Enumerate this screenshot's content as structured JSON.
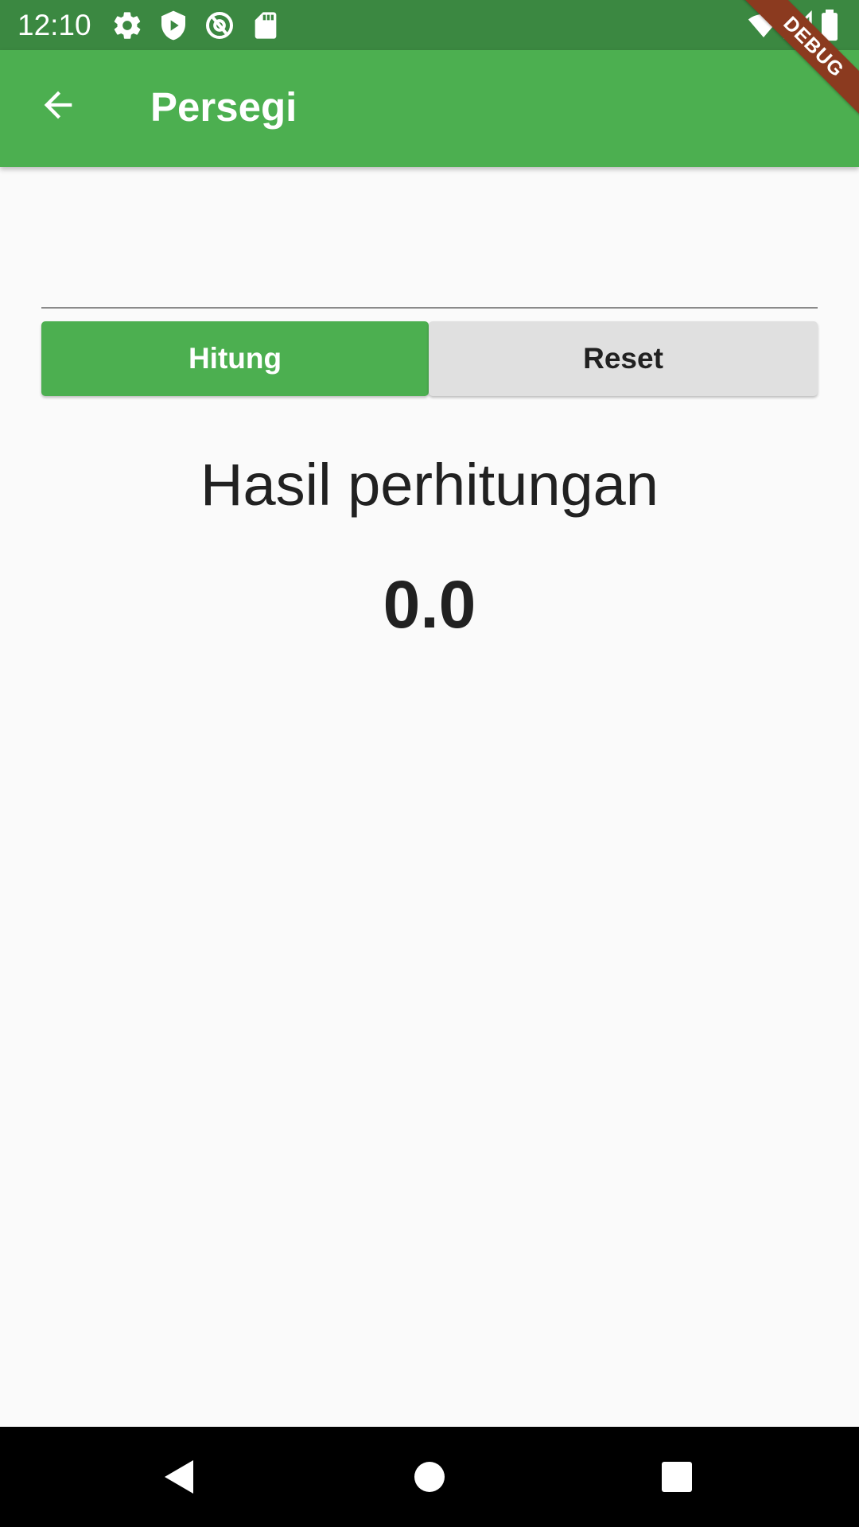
{
  "status_bar": {
    "time": "12:10",
    "left_icons": [
      "gear-icon",
      "shield-play-icon",
      "at-sign-icon",
      "sd-card-icon"
    ],
    "right_icons": [
      "wifi-icon",
      "cell-signal-icon",
      "battery-icon"
    ]
  },
  "app_bar": {
    "title": "Persegi",
    "back_icon": "arrow-back-icon"
  },
  "debug_banner": {
    "label": "DEBUG"
  },
  "buttons": {
    "hitung_label": "Hitung",
    "reset_label": "Reset"
  },
  "result": {
    "label": "Hasil perhitungan",
    "value": "0.0"
  },
  "nav_bar": {
    "icons": [
      "back-triangle-icon",
      "home-circle-icon",
      "recents-square-icon"
    ]
  },
  "colors": {
    "primary": "#4caf50",
    "status_bar": "#3b8841",
    "debug_banner": "#8b3a1f",
    "reset_button": "#e0e0e0"
  }
}
